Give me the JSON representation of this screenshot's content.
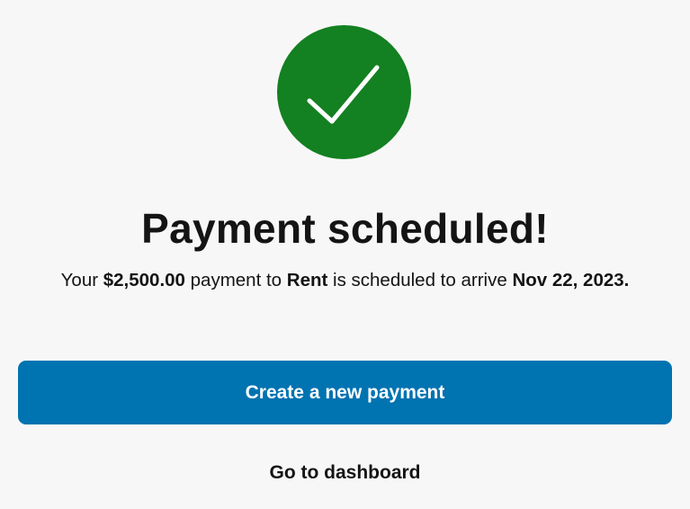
{
  "status_icon": {
    "name": "checkmark-icon",
    "background_color": "#138021",
    "check_color": "#ffffff"
  },
  "confirmation": {
    "title": "Payment scheduled!",
    "message": {
      "prefix": "Your ",
      "amount": "$2,500.00",
      "middle1": " payment to ",
      "payee": "Rent",
      "middle2": " is scheduled to arrive ",
      "date": "Nov 22, 2023."
    }
  },
  "actions": {
    "create_label": "Create a new payment",
    "dashboard_label": "Go to dashboard"
  },
  "colors": {
    "accent": "#0073b1",
    "success": "#138021",
    "background": "#f7f7f7"
  }
}
